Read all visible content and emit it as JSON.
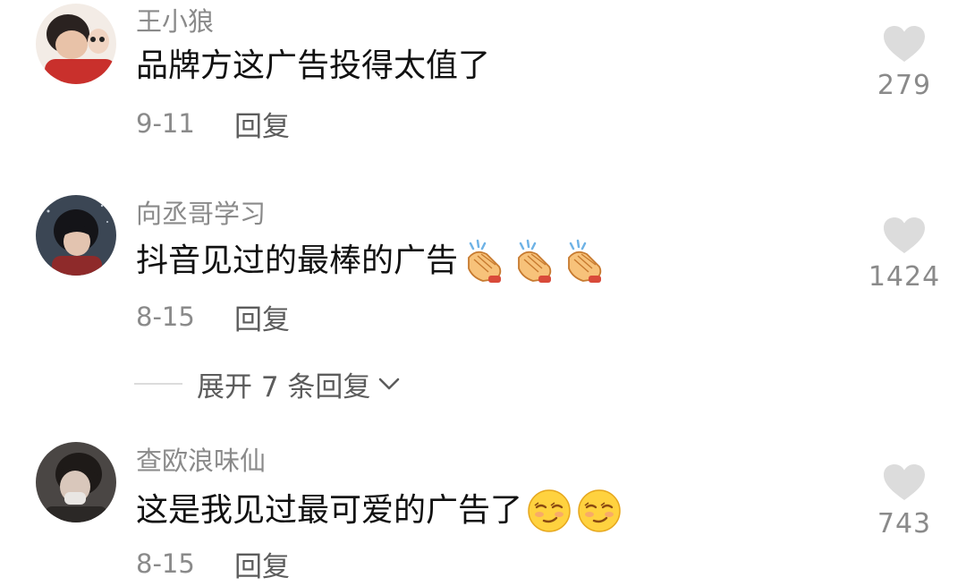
{
  "comments": [
    {
      "username": "王小狼",
      "content": "品牌方这广告投得太值了",
      "emoji": [],
      "date": "9-11",
      "reply_label": "回复",
      "likes": "279"
    },
    {
      "username": "向丞哥学习",
      "content": "抖音见过的最棒的广告",
      "emoji": [
        "clapping-hands-emoji",
        "clapping-hands-emoji",
        "clapping-hands-emoji"
      ],
      "date": "8-15",
      "reply_label": "回复",
      "likes": "1424"
    },
    {
      "username": "查欧浪味仙",
      "content": "这是我见过最可爱的广告了",
      "emoji": [
        "smirking-face-emoji",
        "smirking-face-emoji"
      ],
      "date": "8-15",
      "reply_label": "回复",
      "likes": "743"
    }
  ],
  "expand_replies": {
    "label": "展开 7 条回复"
  },
  "colors": {
    "heart": "#dcdcdc",
    "secondary_text": "#8a8a8a",
    "primary_text": "#111111"
  }
}
